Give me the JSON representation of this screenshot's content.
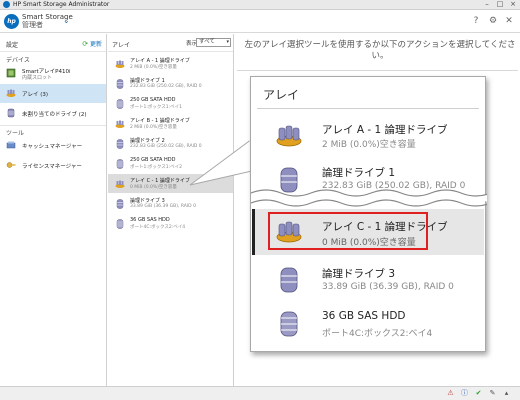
{
  "titlebar": {
    "title": "HP Smart Storage Administrator"
  },
  "header": {
    "app_line1": "Smart Storage",
    "app_line2": "管理者",
    "logo_text": "hp"
  },
  "left_nav": {
    "heading": "設定",
    "refresh_label": "更新",
    "devices_section": "デバイス",
    "tools_section": "ツール",
    "items": [
      {
        "title": "SmartアレイP410i",
        "subtitle": "内蔵スロット"
      },
      {
        "title": "アレイ (3)"
      },
      {
        "title": "未割り当てのドライブ (2)"
      },
      {
        "title": "キャッシュマネージャー"
      },
      {
        "title": "ライセンスマネージャー"
      }
    ]
  },
  "middle_list": {
    "heading": "アレイ",
    "filter_label": "表示",
    "filter_value": "すべて",
    "items": [
      {
        "title": "アレイ A - 1 論理ドライブ",
        "subtitle": "2 MiB (0.0%)空き容量"
      },
      {
        "title": "論理ドライブ 1",
        "subtitle": "232.83 GiB (250.02 GB), RAID 0"
      },
      {
        "title": "250 GB SATA HDD",
        "subtitle": "ポート1:ボックス1:ベイ1"
      },
      {
        "title": "アレイ B - 1 論理ドライブ",
        "subtitle": "2 MiB (0.0%)空き容量"
      },
      {
        "title": "論理ドライブ 2",
        "subtitle": "232.83 GiB (250.02 GB), RAID 0"
      },
      {
        "title": "250 GB SATA HDD",
        "subtitle": "ポート1:ボックス1:ベイ2"
      },
      {
        "title": "アレイ C - 1 論理ドライブ",
        "subtitle": "0 MiB (0.0%)空き容量"
      },
      {
        "title": "論理ドライブ 3",
        "subtitle": "33.89 GiB (36.39 GB), RAID 0"
      },
      {
        "title": "36 GB SAS HDD",
        "subtitle": "ポート4C:ボックス2:ベイ4"
      }
    ]
  },
  "main": {
    "message": "左のアレイ選択ツールを使用するか以下のアクションを選択してください。"
  },
  "callout": {
    "title": "アレイ",
    "items": [
      {
        "title": "アレイ A - 1 論理ドライブ",
        "subtitle": "2 MiB (0.0%)空き容量"
      },
      {
        "title": "論理ドライブ 1",
        "subtitle": "232.83 GiB (250.02 GB), RAID 0"
      },
      {
        "title": "アレイ C - 1 論理ドライブ",
        "subtitle": "0 MiB (0.0%)空き容量"
      },
      {
        "title": "論理ドライブ 3",
        "subtitle": "33.89 GiB (36.39 GB), RAID 0"
      },
      {
        "title": "36 GB SAS HDD",
        "subtitle": "ポート4C:ボックス2:ベイ4"
      }
    ]
  },
  "colors": {
    "accent": "#0a6ebd",
    "selected_nav": "#cfe4f5",
    "highlight_box": "#e02020"
  },
  "icons": [
    "hp-logo-icon",
    "refresh-icon",
    "help-icon",
    "settings-icon",
    "close-icon",
    "array-icon",
    "logical-drive-icon",
    "hdd-icon",
    "controller-icon",
    "cache-icon",
    "license-icon"
  ]
}
